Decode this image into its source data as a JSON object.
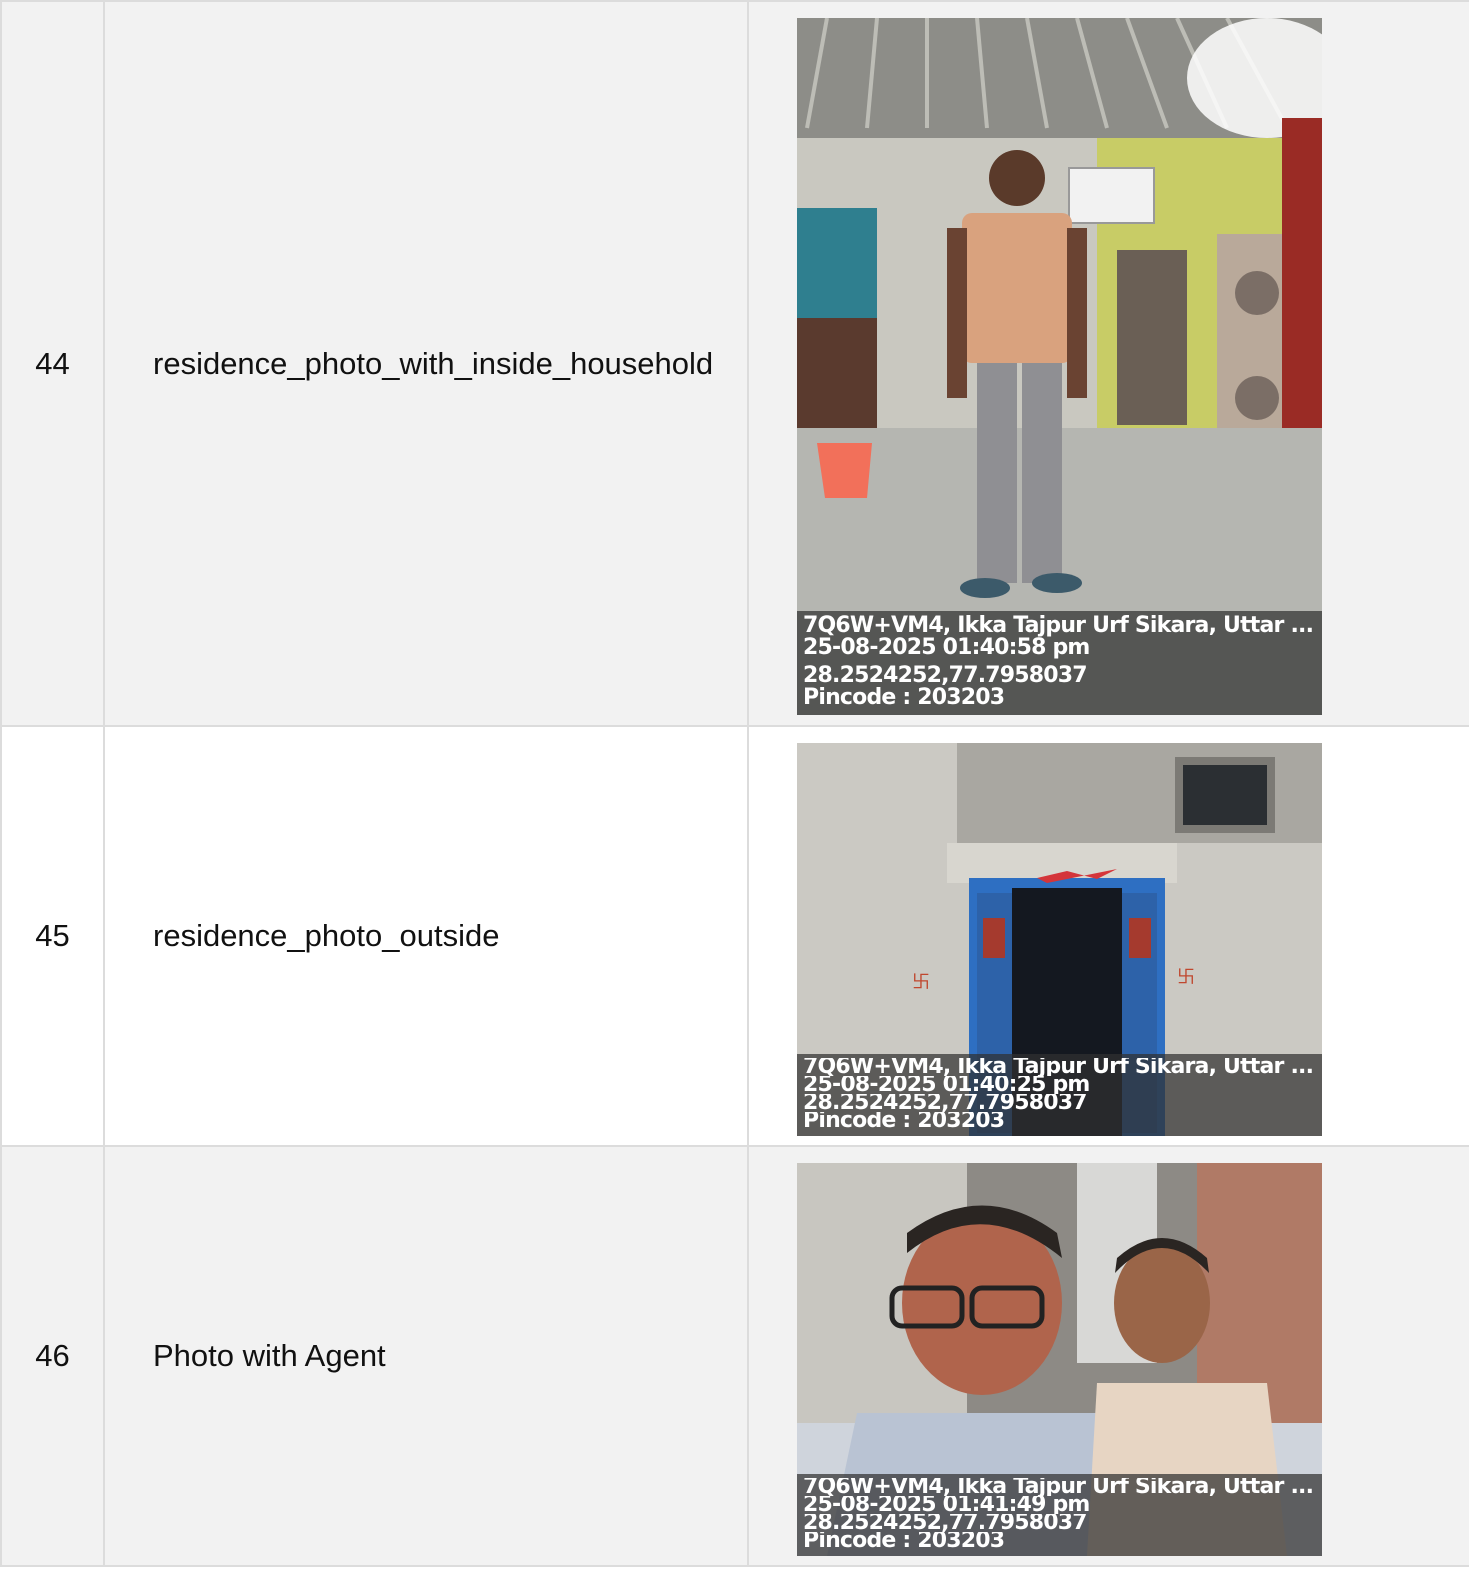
{
  "rows": [
    {
      "number": "44",
      "label": "residence_photo_with_inside_household",
      "photo": {
        "subject": "man standing inside a room",
        "stamp": {
          "address": "7Q6W+VM4, Ikka Tajpur Urf Sikara, Uttar ...",
          "datetime": "25-08-2025 01:40:58 pm",
          "coordinates": "28.2524252,77.7958037",
          "pincode": "Pincode : 203203"
        }
      }
    },
    {
      "number": "45",
      "label": "residence_photo_outside",
      "photo": {
        "subject": "house exterior with blue door",
        "stamp": {
          "address": "7Q6W+VM4, Ikka Tajpur Urf Sikara, Uttar ...",
          "datetime": "25-08-2025 01:40:25 pm",
          "coordinates": "28.2524252,77.7958037",
          "pincode": "Pincode : 203203"
        }
      }
    },
    {
      "number": "46",
      "label": "Photo with Agent",
      "photo": {
        "subject": "selfie of agent with customer",
        "stamp": {
          "address": "7Q6W+VM4, Ikka Tajpur Urf Sikara, Uttar ...",
          "datetime": "25-08-2025 01:41:49 pm",
          "coordinates": "28.2524252,77.7958037",
          "pincode": "Pincode : 203203"
        }
      }
    }
  ],
  "colors": {
    "row_shaded": "#f2f2f2",
    "row_plain": "#ffffff",
    "border": "#dcdcdc",
    "stamp_bg": "#303030"
  }
}
